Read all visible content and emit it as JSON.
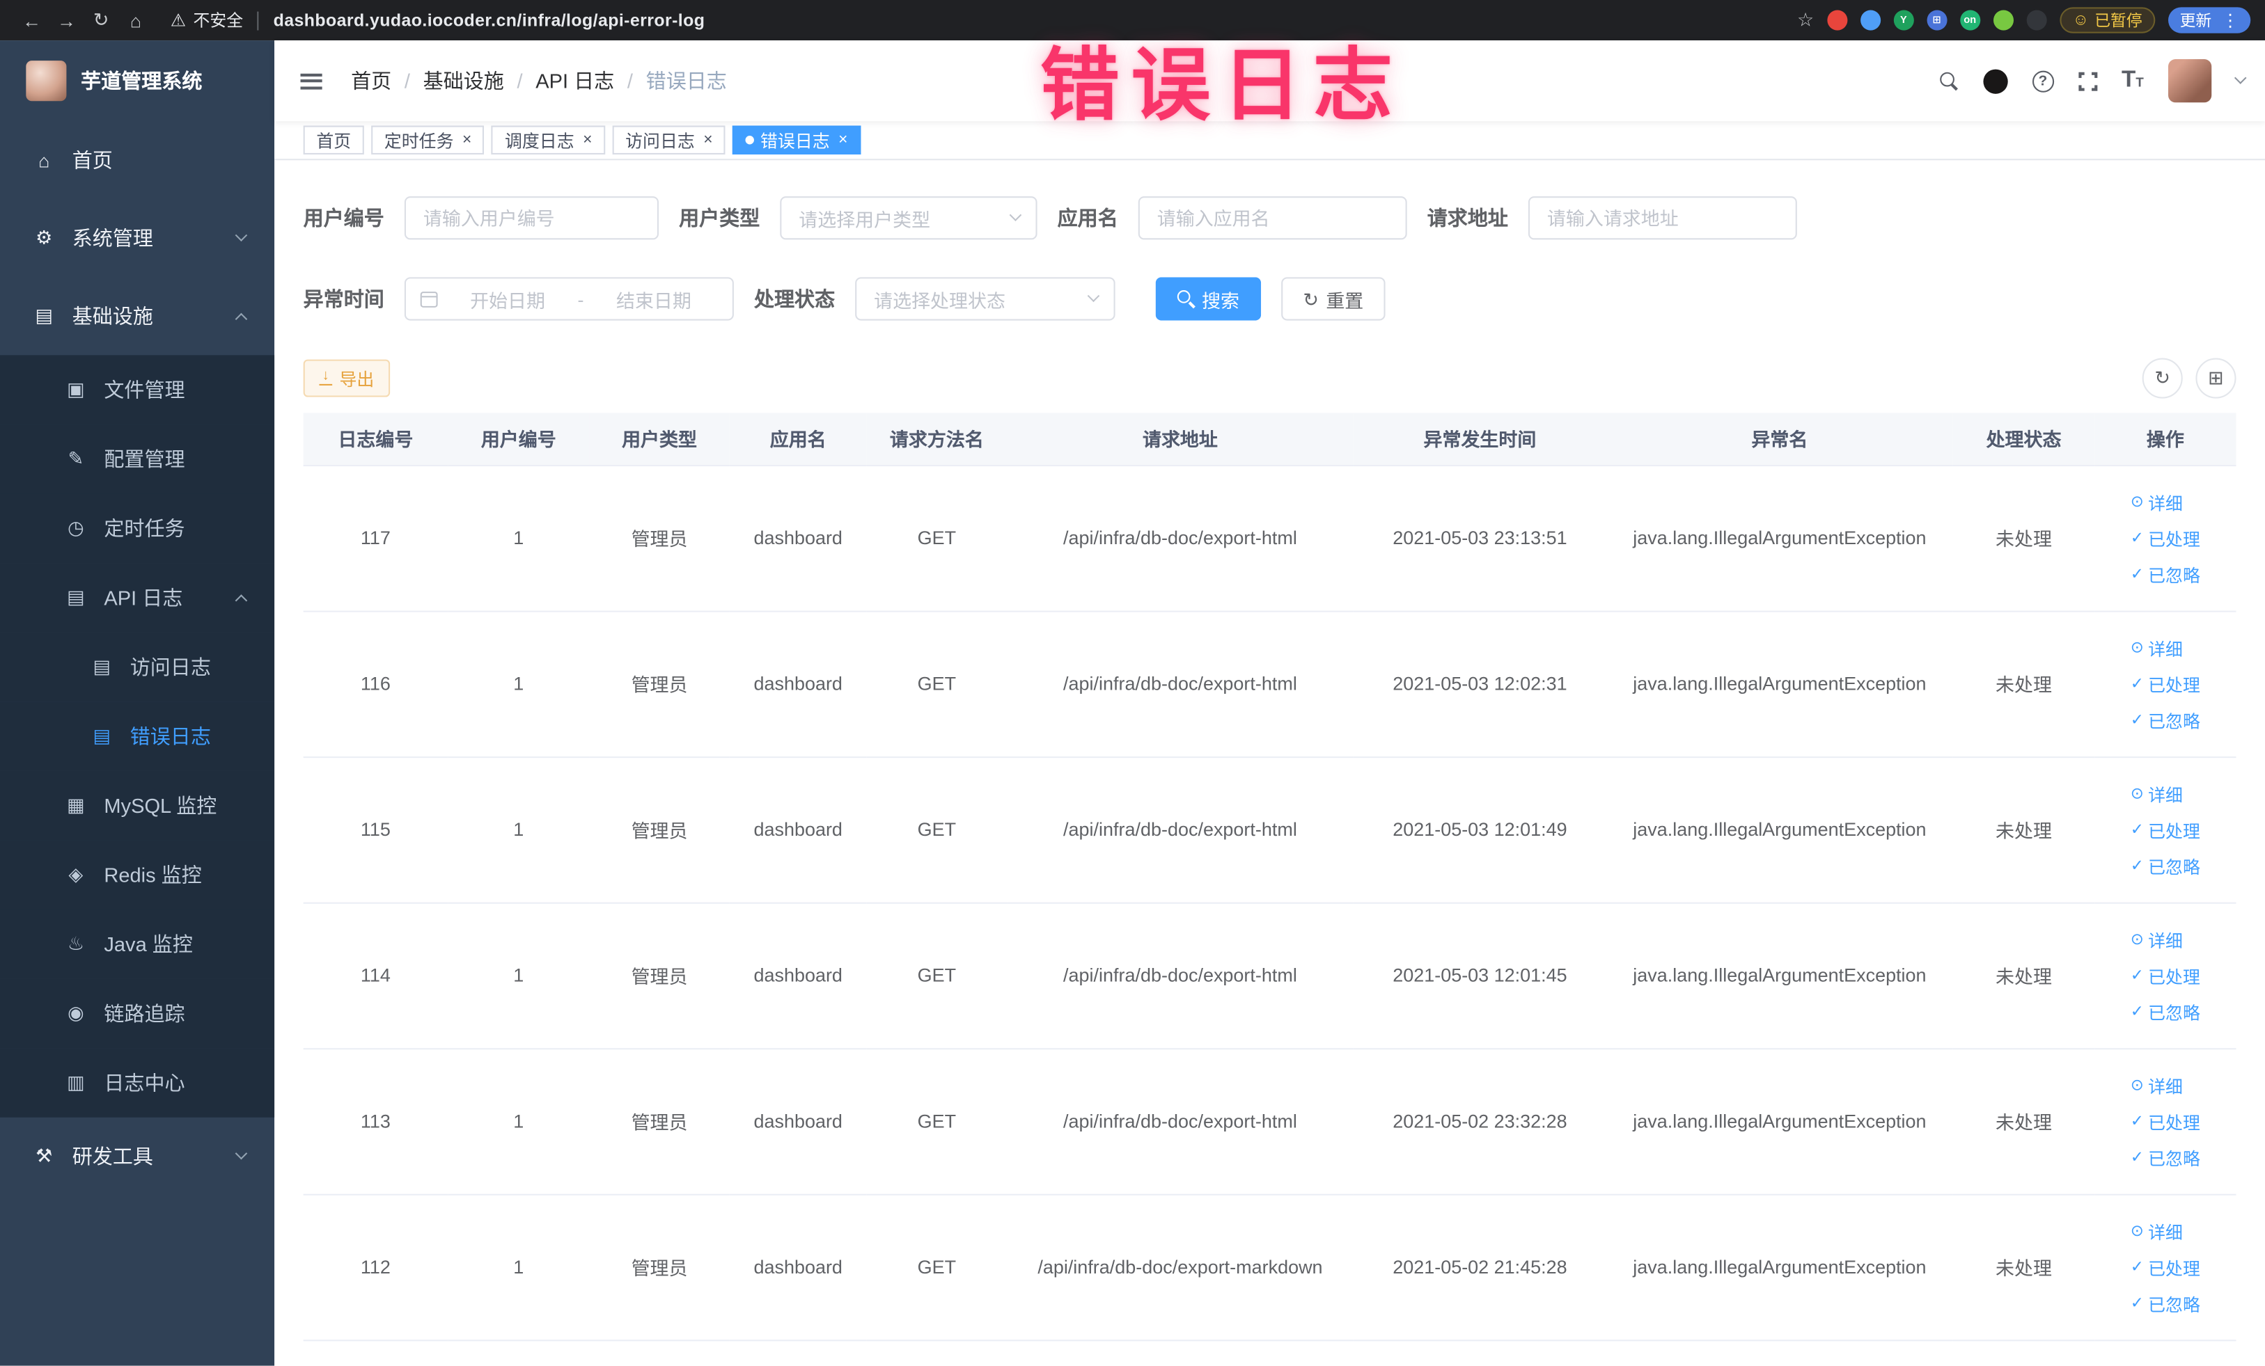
{
  "accent": "#409eff",
  "annotation": "错误日志",
  "browser": {
    "security_label": "不安全",
    "url": "dashboard.yudao.iocoder.cn/infra/log/api-error-log",
    "paused_badge": "已暂停",
    "update_label": "更新",
    "extensions": [
      {
        "name": "extension-red-circle-icon",
        "color": "#e8453c",
        "glyph": ""
      },
      {
        "name": "extension-blue-drop-icon",
        "color": "#4f9ef7",
        "glyph": ""
      },
      {
        "name": "extension-green-circle-icon",
        "color": "#1fa15d",
        "glyph": "Y"
      },
      {
        "name": "extension-blue-grid-icon",
        "color": "#4a73d8",
        "glyph": "⊞"
      },
      {
        "name": "extension-on-switch-icon",
        "color": "#21b573",
        "glyph": "on"
      },
      {
        "name": "extension-leaf-icon",
        "color": "#78c841",
        "glyph": ""
      },
      {
        "name": "extension-paw-icon",
        "color": "#33363b",
        "glyph": ""
      }
    ]
  },
  "sidebar": {
    "logo_title": "芋道管理系统",
    "menu": [
      {
        "id": "home",
        "label": "首页",
        "icon": "home-icon",
        "glyph": "⌂",
        "level": 1,
        "sub": false,
        "active": false,
        "chevron": ""
      },
      {
        "id": "system",
        "label": "系统管理",
        "icon": "gear-icon",
        "glyph": "⚙",
        "level": 1,
        "sub": false,
        "active": false,
        "chevron": "down"
      },
      {
        "id": "infrastructure",
        "label": "基础设施",
        "icon": "monitor-icon",
        "glyph": "▤",
        "level": 1,
        "sub": false,
        "active": false,
        "chevron": "up"
      },
      {
        "id": "file-manage",
        "label": "文件管理",
        "icon": "cloud-icon",
        "glyph": "▣",
        "level": 2,
        "sub": true,
        "active": false,
        "chevron": ""
      },
      {
        "id": "config-manage",
        "label": "配置管理",
        "icon": "edit-icon",
        "glyph": "✎",
        "level": 2,
        "sub": true,
        "active": false,
        "chevron": ""
      },
      {
        "id": "scheduled-jobs",
        "label": "定时任务",
        "icon": "timer-icon",
        "glyph": "◷",
        "level": 2,
        "sub": true,
        "active": false,
        "chevron": ""
      },
      {
        "id": "api-log",
        "label": "API 日志",
        "icon": "log-icon",
        "glyph": "▤",
        "level": 2,
        "sub": true,
        "active": false,
        "chevron": "up"
      },
      {
        "id": "access-log",
        "label": "访问日志",
        "icon": "document-icon",
        "glyph": "▤",
        "level": 3,
        "sub": true,
        "active": false,
        "chevron": ""
      },
      {
        "id": "error-log",
        "label": "错误日志",
        "icon": "document-icon",
        "glyph": "▤",
        "level": 3,
        "sub": true,
        "active": true,
        "chevron": ""
      },
      {
        "id": "mysql-monitor",
        "label": "MySQL 监控",
        "icon": "mysql-icon",
        "glyph": "▦",
        "level": 2,
        "sub": true,
        "active": false,
        "chevron": ""
      },
      {
        "id": "redis-monitor",
        "label": "Redis 监控",
        "icon": "redis-icon",
        "glyph": "◈",
        "level": 2,
        "sub": true,
        "active": false,
        "chevron": ""
      },
      {
        "id": "java-monitor",
        "label": "Java 监控",
        "icon": "java-icon",
        "glyph": "♨",
        "level": 2,
        "sub": true,
        "active": false,
        "chevron": ""
      },
      {
        "id": "link-trace",
        "label": "链路追踪",
        "icon": "eye-icon",
        "glyph": "◉",
        "level": 2,
        "sub": true,
        "active": false,
        "chevron": ""
      },
      {
        "id": "log-center",
        "label": "日志中心",
        "icon": "log-center-icon",
        "glyph": "▥",
        "level": 2,
        "sub": true,
        "active": false,
        "chevron": ""
      },
      {
        "id": "dev-tools",
        "label": "研发工具",
        "icon": "tools-icon",
        "glyph": "⚒",
        "level": 1,
        "sub": false,
        "active": false,
        "chevron": "down"
      }
    ]
  },
  "navbar": {
    "breadcrumb": [
      {
        "label": "首页",
        "current": false
      },
      {
        "label": "基础设施",
        "current": false
      },
      {
        "label": "API 日志",
        "current": false
      },
      {
        "label": "错误日志",
        "current": true
      }
    ]
  },
  "tabs": [
    {
      "label": "首页",
      "closable": false,
      "active": false
    },
    {
      "label": "定时任务",
      "closable": true,
      "active": false
    },
    {
      "label": "调度日志",
      "closable": true,
      "active": false
    },
    {
      "label": "访问日志",
      "closable": true,
      "active": false
    },
    {
      "label": "错误日志",
      "closable": true,
      "active": true
    }
  ],
  "filters": {
    "user_id": {
      "label": "用户编号",
      "placeholder": "请输入用户编号",
      "value": ""
    },
    "user_type": {
      "label": "用户类型",
      "placeholder": "请选择用户类型"
    },
    "app_name": {
      "label": "应用名",
      "placeholder": "请输入应用名",
      "value": ""
    },
    "request_url": {
      "label": "请求地址",
      "placeholder": "请输入请求地址",
      "value": ""
    },
    "exception_time": {
      "label": "异常时间",
      "start_placeholder": "开始日期",
      "separator": "-",
      "end_placeholder": "结束日期"
    },
    "process_status": {
      "label": "处理状态",
      "placeholder": "请选择处理状态"
    },
    "search_label": "搜索",
    "reset_label": "重置"
  },
  "toolbar": {
    "export_label": "导出"
  },
  "table": {
    "columns": [
      "日志编号",
      "用户编号",
      "用户类型",
      "应用名",
      "请求方法名",
      "请求地址",
      "异常发生时间",
      "异常名",
      "处理状态",
      "操作"
    ],
    "rows": [
      {
        "id": "117",
        "user_id": "1",
        "user_type": "管理员",
        "app": "dashboard",
        "method": "GET",
        "url": "/api/infra/db-doc/export-html",
        "time": "2021-05-03 23:13:51",
        "exception": "java.lang.IllegalArgumentException",
        "status": "未处理"
      },
      {
        "id": "116",
        "user_id": "1",
        "user_type": "管理员",
        "app": "dashboard",
        "method": "GET",
        "url": "/api/infra/db-doc/export-html",
        "time": "2021-05-03 12:02:31",
        "exception": "java.lang.IllegalArgumentException",
        "status": "未处理"
      },
      {
        "id": "115",
        "user_id": "1",
        "user_type": "管理员",
        "app": "dashboard",
        "method": "GET",
        "url": "/api/infra/db-doc/export-html",
        "time": "2021-05-03 12:01:49",
        "exception": "java.lang.IllegalArgumentException",
        "status": "未处理"
      },
      {
        "id": "114",
        "user_id": "1",
        "user_type": "管理员",
        "app": "dashboard",
        "method": "GET",
        "url": "/api/infra/db-doc/export-html",
        "time": "2021-05-03 12:01:45",
        "exception": "java.lang.IllegalArgumentException",
        "status": "未处理"
      },
      {
        "id": "113",
        "user_id": "1",
        "user_type": "管理员",
        "app": "dashboard",
        "method": "GET",
        "url": "/api/infra/db-doc/export-html",
        "time": "2021-05-02 23:32:28",
        "exception": "java.lang.IllegalArgumentException",
        "status": "未处理"
      },
      {
        "id": "112",
        "user_id": "1",
        "user_type": "管理员",
        "app": "dashboard",
        "method": "GET",
        "url": "/api/infra/db-doc/export-markdown",
        "time": "2021-05-02 21:45:28",
        "exception": "java.lang.IllegalArgumentException",
        "status": "未处理"
      }
    ],
    "row_actions": [
      {
        "id": "detail",
        "label": "详细",
        "icon": "eye-icon",
        "glyph": "⊙"
      },
      {
        "id": "processed",
        "label": "已处理",
        "icon": "check-icon",
        "glyph": "✓"
      },
      {
        "id": "ignored",
        "label": "已忽略",
        "icon": "check-icon",
        "glyph": "✓"
      }
    ]
  }
}
